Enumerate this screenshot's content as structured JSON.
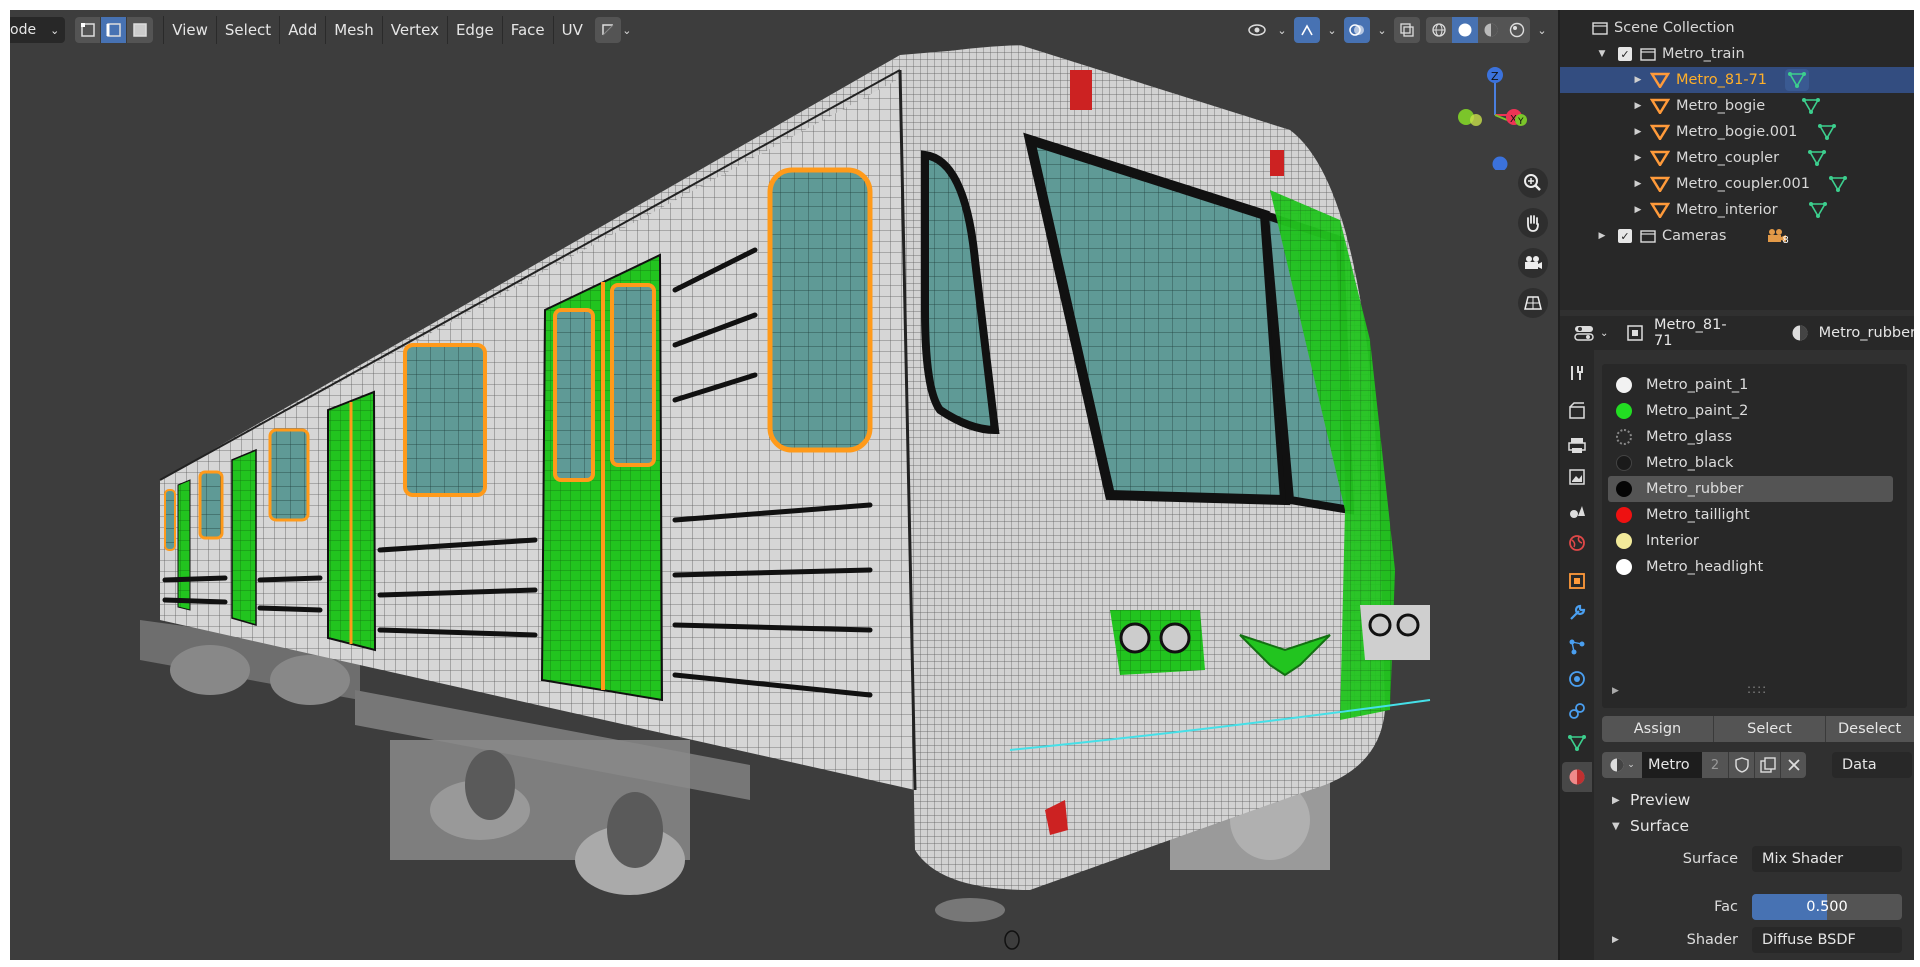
{
  "viewport": {
    "mode_label": "ode",
    "menu": [
      "View",
      "Select",
      "Add",
      "Mesh",
      "Vertex",
      "Edge",
      "Face",
      "UV"
    ],
    "gizmo": {
      "z_label": "Z",
      "y_label": "Y"
    }
  },
  "outliner": {
    "root": "Scene Collection",
    "collections": [
      {
        "name": "Metro_train",
        "level": 1,
        "expanded": true,
        "checked": true,
        "type": "collection"
      },
      {
        "name": "Metro_81-71",
        "level": 2,
        "selected": true,
        "type": "mesh"
      },
      {
        "name": "Metro_bogie",
        "level": 2,
        "type": "mesh"
      },
      {
        "name": "Metro_bogie.001",
        "level": 2,
        "type": "mesh"
      },
      {
        "name": "Metro_coupler",
        "level": 2,
        "type": "mesh"
      },
      {
        "name": "Metro_coupler.001",
        "level": 2,
        "type": "mesh"
      },
      {
        "name": "Metro_interior",
        "level": 2,
        "type": "mesh"
      },
      {
        "name": "Cameras",
        "level": 1,
        "checked": true,
        "type": "collection",
        "camera_count": "8"
      }
    ]
  },
  "properties": {
    "object_name": "Metro_81-71",
    "material_name": "Metro_rubber",
    "slots": [
      {
        "name": "Metro_paint_1",
        "color": "#f2f2f2"
      },
      {
        "name": "Metro_paint_2",
        "color": "#22dd22"
      },
      {
        "name": "Metro_glass",
        "color": "#888888"
      },
      {
        "name": "Metro_black",
        "color": "#1a1a1a"
      },
      {
        "name": "Metro_rubber",
        "color": "#050505",
        "selected": true
      },
      {
        "name": "Metro_taillight",
        "color": "#ee1111"
      },
      {
        "name": "Interior",
        "color": "#f2ea9a"
      },
      {
        "name": "Metro_headlight",
        "color": "#ffffff"
      }
    ],
    "buttons": {
      "assign": "Assign",
      "select": "Select",
      "deselect": "Deselect"
    },
    "material_field": "Metro",
    "material_users": "2",
    "link": "Data",
    "panels": {
      "preview": "Preview",
      "surface": "Surface"
    },
    "surface_label": "Surface",
    "surface_value": "Mix Shader",
    "fac_label": "Fac",
    "fac_value": "0.500",
    "fac_fraction": 0.5,
    "shader_label": "Shader",
    "shader_value": "Diffuse BSDF"
  },
  "colors": {
    "accent": "#4772b3",
    "selection": "#334d80",
    "orange": "#ffaf29",
    "mesh_green": "#3ccf8e"
  }
}
